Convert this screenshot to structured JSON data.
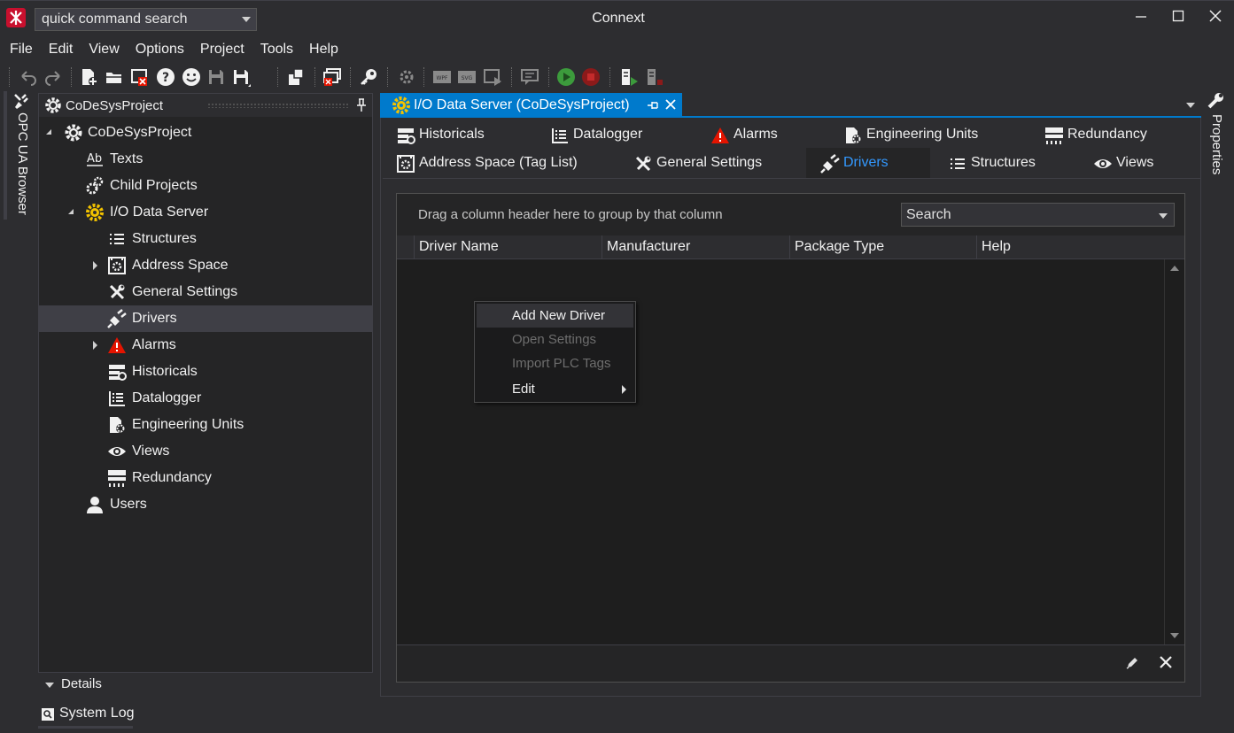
{
  "window": {
    "title": "Connext",
    "quick_search_placeholder": "quick command search",
    "logo_icon": "connext-logo-icon",
    "controls": [
      "minimize-icon",
      "maximize-icon",
      "close-icon"
    ]
  },
  "menu": [
    "File",
    "Edit",
    "View",
    "Options",
    "Project",
    "Tools",
    "Help"
  ],
  "side_tabs": {
    "left": "OPC UA Browser",
    "right": "Properties"
  },
  "project_panel": {
    "title": "CoDeSysProject",
    "pin_icon": "pin-icon",
    "tree": [
      {
        "label": "CoDeSysProject",
        "icon": "gear-icon",
        "level": 0,
        "expander": "open"
      },
      {
        "label": "Texts",
        "icon": "text-ab-icon",
        "level": 1
      },
      {
        "label": "Child Projects",
        "icon": "child-projects-icon",
        "level": 1
      },
      {
        "label": "I/O Data Server",
        "icon": "sun-gear-icon",
        "level": 1,
        "expander": "open"
      },
      {
        "label": "Structures",
        "icon": "list-icon",
        "level": 2
      },
      {
        "label": "Address Space",
        "icon": "address-space-icon",
        "level": 2,
        "expander": "closed"
      },
      {
        "label": "General Settings",
        "icon": "tools-icon",
        "level": 2
      },
      {
        "label": "Drivers",
        "icon": "plug-icon",
        "level": 2,
        "selected": true
      },
      {
        "label": "Alarms",
        "icon": "alarm-icon",
        "level": 2,
        "expander": "closed"
      },
      {
        "label": "Historicals",
        "icon": "historicals-icon",
        "level": 2
      },
      {
        "label": "Datalogger",
        "icon": "datalogger-icon",
        "level": 2
      },
      {
        "label": "Engineering Units",
        "icon": "engineering-units-icon",
        "level": 2
      },
      {
        "label": "Views",
        "icon": "eye-icon",
        "level": 2
      },
      {
        "label": "Redundancy",
        "icon": "redundancy-icon",
        "level": 2
      },
      {
        "label": "Users",
        "icon": "user-icon",
        "level": 1
      }
    ],
    "details_label": "Details",
    "system_log_label": "System Log"
  },
  "document": {
    "tab_title": "I/O Data Server (CoDeSysProject)",
    "subtabs_row1": [
      {
        "label": "Historicals",
        "icon": "historicals-icon"
      },
      {
        "label": "Datalogger",
        "icon": "datalogger-icon"
      },
      {
        "label": "Alarms",
        "icon": "alarm-icon"
      },
      {
        "label": "Engineering Units",
        "icon": "engineering-units-icon"
      },
      {
        "label": "Redundancy",
        "icon": "redundancy-icon"
      }
    ],
    "subtabs_row2": [
      {
        "label": "Address Space (Tag List)",
        "icon": "address-space-icon"
      },
      {
        "label": "General Settings",
        "icon": "tools-icon"
      },
      {
        "label": "Drivers",
        "icon": "plug-icon",
        "active": true
      },
      {
        "label": "Structures",
        "icon": "list-icon"
      },
      {
        "label": "Views",
        "icon": "eye-icon"
      }
    ],
    "grid": {
      "group_hint": "Drag a column header here to group by that column",
      "search_placeholder": "Search",
      "columns": [
        "Driver Name",
        "Manufacturer",
        "Package Type",
        "Help"
      ],
      "rows": []
    }
  },
  "context_menu": {
    "items": [
      {
        "label": "Add New Driver",
        "enabled": true,
        "highlighted": true
      },
      {
        "label": "Open Settings",
        "enabled": false
      },
      {
        "label": "Import PLC Tags",
        "enabled": false
      },
      {
        "label": "Edit",
        "enabled": true,
        "submenu": true
      }
    ]
  },
  "colors": {
    "accent": "#007acc",
    "active_tab_text": "#3399ff",
    "background": "#2d2d30",
    "panel": "#252526",
    "alarm_red": "#e51400",
    "sun_yellow": "#f2c200",
    "run_green": "#3c9b3c"
  }
}
